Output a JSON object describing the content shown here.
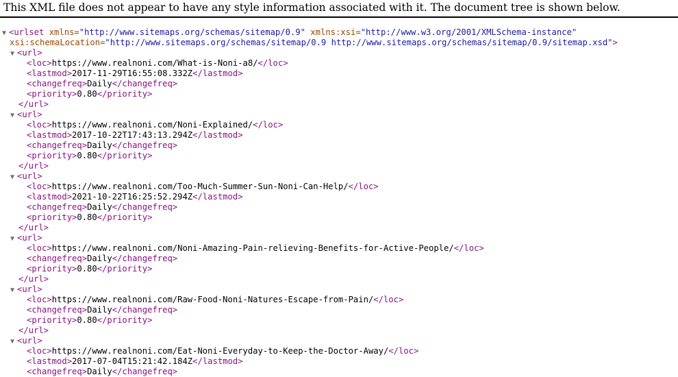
{
  "banner": "This XML file does not appear to have any style information associated with it. The document tree is shown below.",
  "urlset": {
    "open_prefix": "<urlset",
    "xmlns_name": "xmlns=",
    "xmlns_value": "\"http://www.sitemaps.org/schemas/sitemap/0.9\"",
    "xsi_name": "xmlns:xsi=",
    "xsi_value": "\"http://www.w3.org/2001/XMLSchema-instance\"",
    "schema_name": "xsi:schemaLocation=",
    "schema_value": "\"http://www.sitemaps.org/schemas/sitemap/0.9 http://www.sitemaps.org/schemas/sitemap/0.9/sitemap.xsd\"",
    "close_bracket": ">"
  },
  "tags": {
    "url_open": "<url>",
    "url_close": "</url>",
    "loc_open": "<loc>",
    "loc_close": "</loc>",
    "lastmod_open": "<lastmod>",
    "lastmod_close": "</lastmod>",
    "changefreq_open": "<changefreq>",
    "changefreq_close": "</changefreq>",
    "priority_open": "<priority>",
    "priority_close": "</priority>"
  },
  "urls": [
    {
      "loc": "https://www.realnoni.com/What-is-Noni-a8/",
      "lastmod": "2017-11-29T16:55:08.332Z",
      "changefreq": "Daily",
      "priority": "0.80"
    },
    {
      "loc": "https://www.realnoni.com/Noni-Explained/",
      "lastmod": "2017-10-22T17:43:13.294Z",
      "changefreq": "Daily",
      "priority": "0.80"
    },
    {
      "loc": "https://www.realnoni.com/Too-Much-Summer-Sun-Noni-Can-Help/",
      "lastmod": "2021-10-22T16:25:52.294Z",
      "changefreq": "Daily",
      "priority": "0.80"
    },
    {
      "loc": "https://www.realnoni.com/Noni-Amazing-Pain-relieving-Benefits-for-Active-People/",
      "changefreq": "Daily",
      "priority": "0.80"
    },
    {
      "loc": "https://www.realnoni.com/Raw-Food-Noni-Natures-Escape-from-Pain/",
      "changefreq": "Daily",
      "priority": "0.80"
    },
    {
      "loc": "https://www.realnoni.com/Eat-Noni-Everyday-to-Keep-the-Doctor-Away/",
      "lastmod": "2017-07-04T15:21:42.184Z",
      "changefreq": "Daily"
    }
  ],
  "icons": {
    "expanded": "▼"
  }
}
